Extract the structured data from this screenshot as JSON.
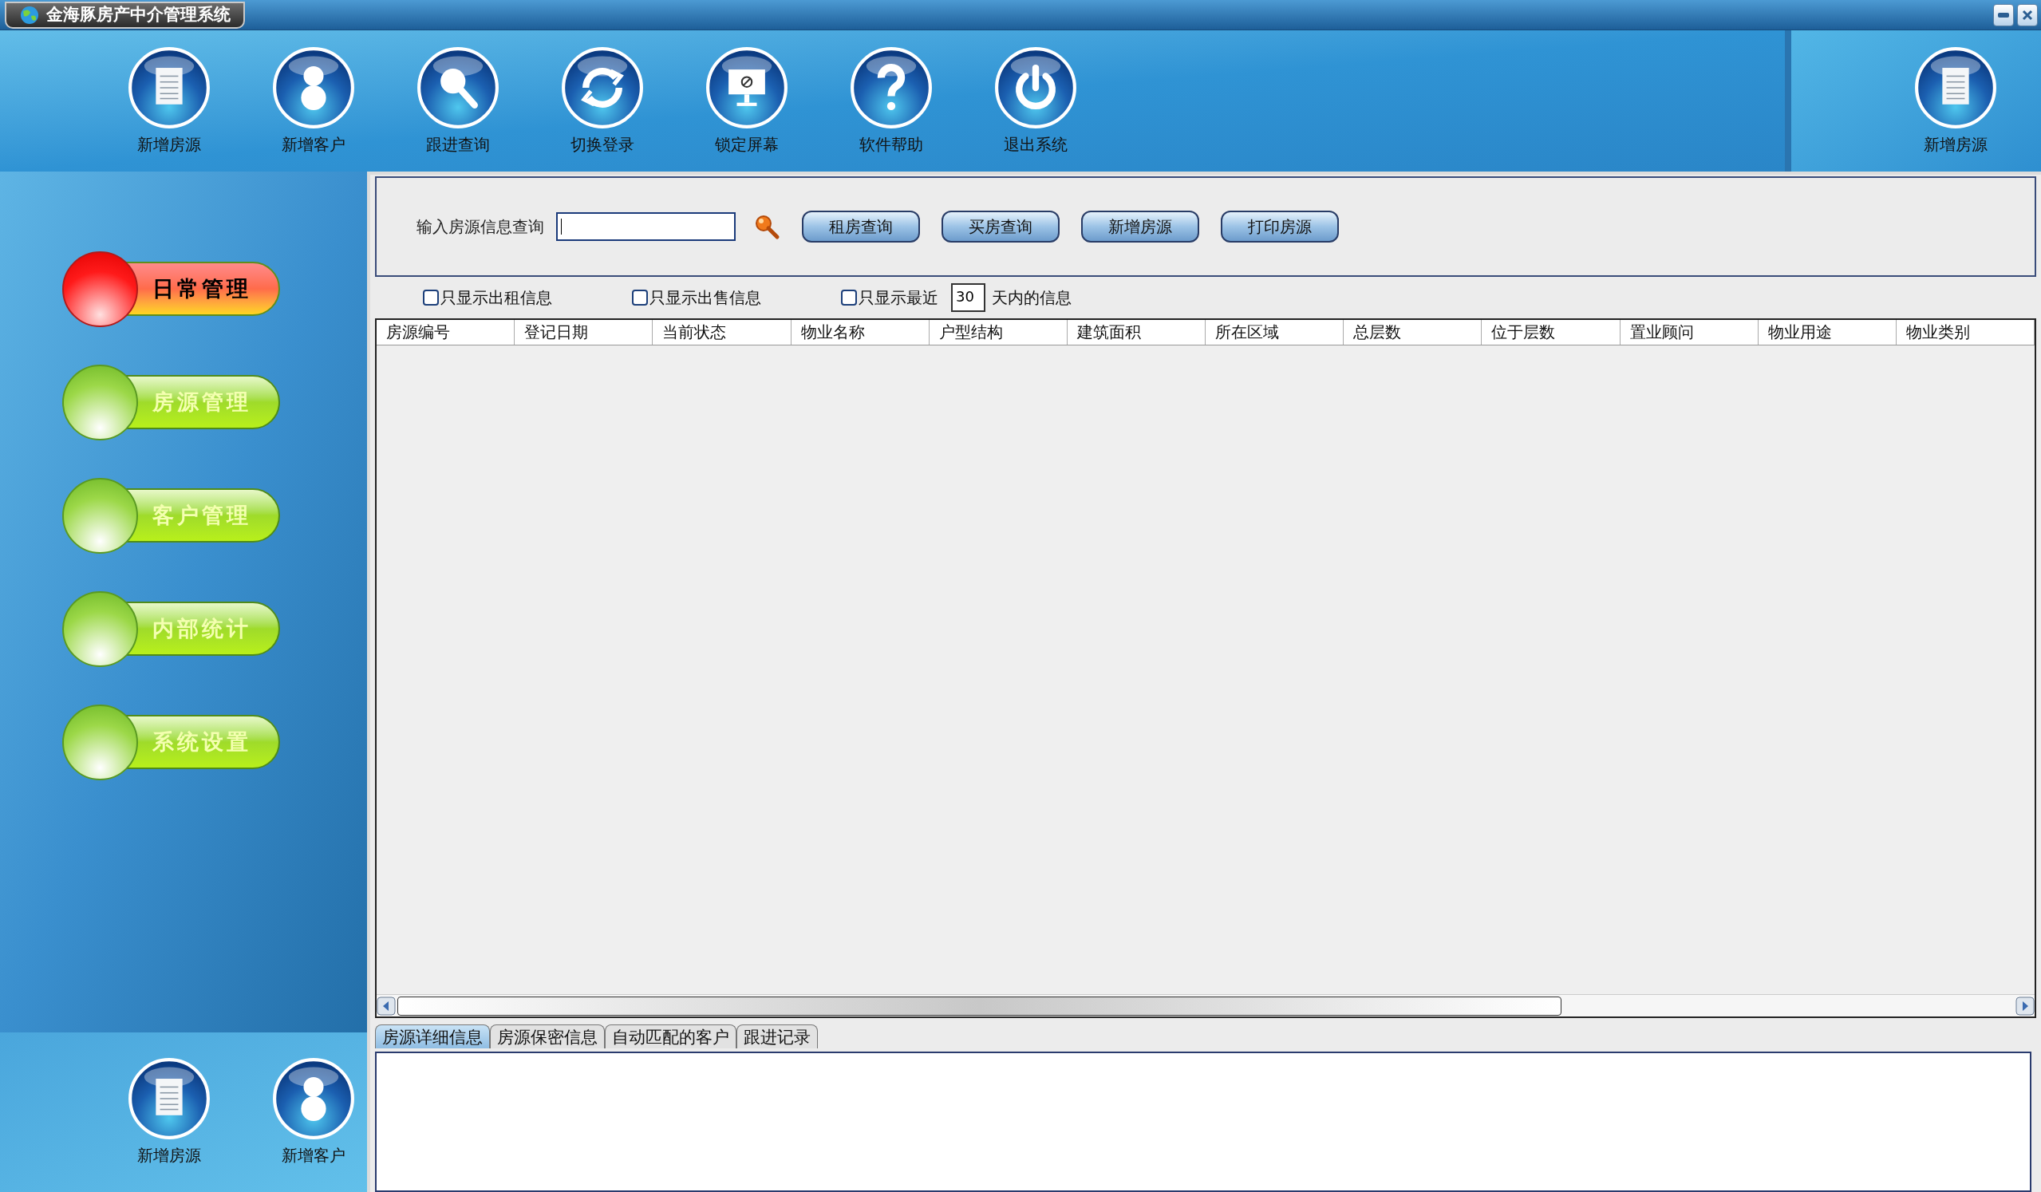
{
  "window": {
    "title": "金海豚房产中介管理系统"
  },
  "toolbar": [
    {
      "label": "新增房源",
      "kind": "document"
    },
    {
      "label": "新增客户",
      "kind": "person"
    },
    {
      "label": "跟进查询",
      "kind": "search"
    },
    {
      "label": "切换登录",
      "kind": "refresh"
    },
    {
      "label": "锁定屏幕",
      "kind": "monitor"
    },
    {
      "label": "软件帮助",
      "kind": "help"
    },
    {
      "label": "退出系统",
      "kind": "power"
    }
  ],
  "side_toolbar": [
    {
      "label": "新增房源",
      "kind": "document"
    }
  ],
  "sidebar": {
    "items": [
      {
        "label": "日常管理",
        "selected": true
      },
      {
        "label": "房源管理",
        "selected": false
      },
      {
        "label": "客户管理",
        "selected": false
      },
      {
        "label": "内部统计",
        "selected": false
      },
      {
        "label": "系统设置",
        "selected": false
      }
    ]
  },
  "sidebar_shortcuts": [
    {
      "label": "新增房源",
      "kind": "document"
    },
    {
      "label": "新增客户",
      "kind": "person"
    }
  ],
  "search": {
    "label": "输入房源信息查询",
    "buttons": [
      "租房查询",
      "买房查询",
      "新增房源",
      "打印房源"
    ]
  },
  "filters": [
    {
      "kind": "checkbox",
      "label": "只显示出租信息",
      "checked": false
    },
    {
      "kind": "checkbox",
      "label": "只显示出售信息",
      "checked": false
    },
    {
      "kind": "days",
      "label": "只显示最近",
      "checked": false,
      "value": "30",
      "suffix": "天内的信息"
    }
  ],
  "table": {
    "columns": [
      "房源编号",
      "登记日期",
      "当前状态",
      "物业名称",
      "户型结构",
      "建筑面积",
      "所在区域",
      "总层数",
      "位于层数",
      "置业顾问",
      "物业用途",
      "物业类别"
    ]
  },
  "detail_tabs": [
    {
      "label": "房源详细信息",
      "selected": true
    },
    {
      "label": "房源保密信息",
      "selected": false
    },
    {
      "label": "自动匹配的客户",
      "selected": false
    },
    {
      "label": "跟进记录",
      "selected": false
    }
  ]
}
